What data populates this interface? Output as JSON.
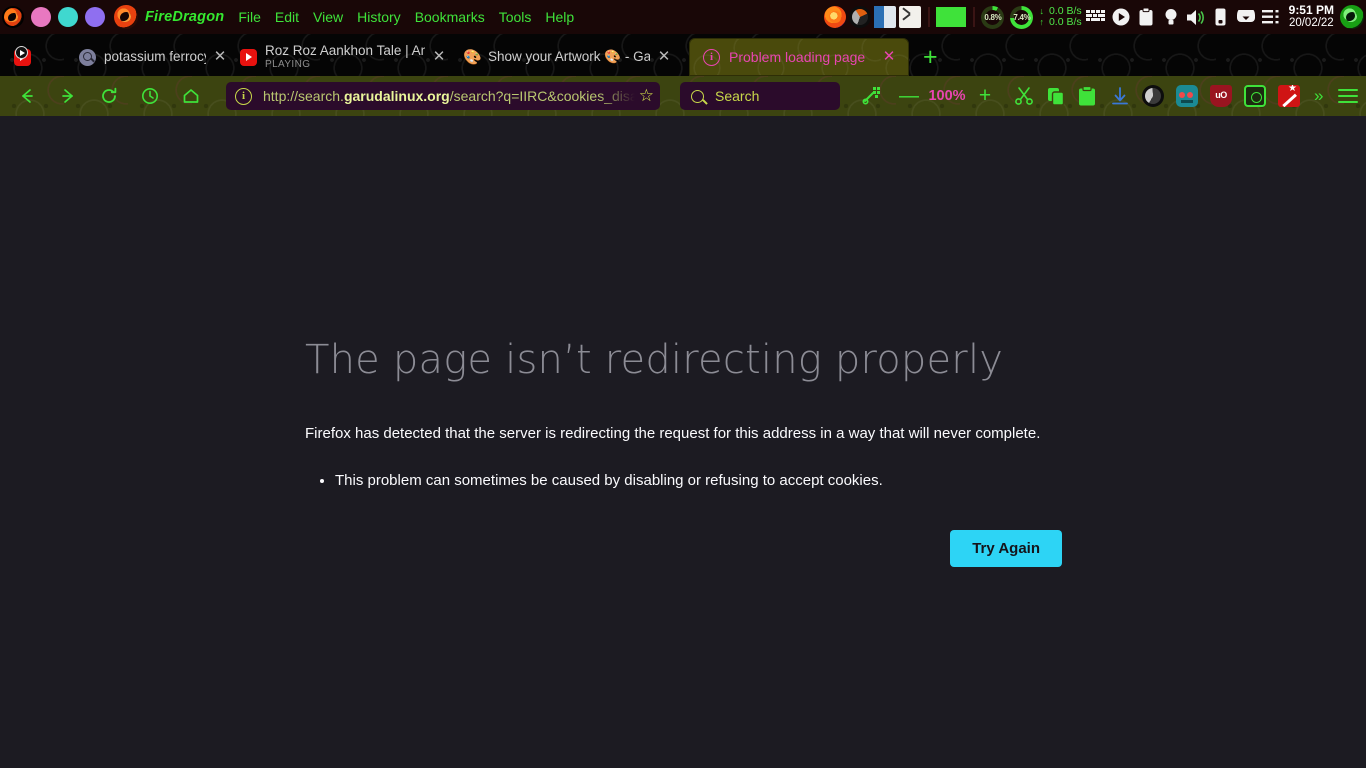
{
  "desktop_panel": {
    "app_name": "FireDragon",
    "menus": [
      "File",
      "Edit",
      "View",
      "History",
      "Bookmarks",
      "Tools",
      "Help"
    ],
    "window_controls": [
      "close-circle",
      "minimize-circle",
      "maximize-circle"
    ],
    "tray": {
      "app_icons": [
        "firefox-icon",
        "dragon-icon",
        "file-manager-icon",
        "terminal-icon"
      ],
      "cpu_label": "0.8%",
      "mem_label": "7.4%",
      "net_down": "0.0 B/s",
      "net_up": "0.0 B/s",
      "status_icons": [
        "keyboard-icon",
        "media-play-icon",
        "clipboard-icon",
        "bulb-icon",
        "volume-icon",
        "battery-icon",
        "cloud-icon",
        "menu-list-icon"
      ],
      "clock_time": "9:51 PM",
      "clock_date": "20/02/22"
    },
    "colors": {
      "panel_bg": "#190707",
      "menu_text": "#3fe23a",
      "app_name_text": "#35e830"
    }
  },
  "tabs": [
    {
      "title": "potassium ferrocyanide - W",
      "subtitle": "",
      "favicon": "search-favicon",
      "active": false,
      "close_label": "✕"
    },
    {
      "title": "Roz Roz Aankhon Tale | Ami",
      "subtitle": "PLAYING",
      "favicon": "youtube-favicon",
      "active": false,
      "close_label": "✕"
    },
    {
      "title": "Show your Artwork 🎨 - Ga",
      "subtitle": "",
      "favicon": "artwork-favicon",
      "active": false,
      "close_label": "✕"
    },
    {
      "title": "Problem loading page",
      "subtitle": "",
      "favicon": "info-favicon",
      "active": true,
      "close_label": "✕"
    }
  ],
  "new_tab_label": "+",
  "toolbar": {
    "back_label": "←",
    "forward_label": "→",
    "reload_label": "⟳",
    "history_label": "◴",
    "home_label": "⌂",
    "url": {
      "scheme": "http://search.",
      "domain": "garudalinux.org",
      "path": "/search?q=IIRC&cookies_disa",
      "full": "http://search.garudalinux.org/search?q=IIRC&cookies_disa",
      "identity_icon": "info-circle-icon",
      "bookmark_star": "☆"
    },
    "search": {
      "placeholder": "Search",
      "icon": "search-icon"
    },
    "zoom_out_label": "—",
    "zoom_level": "100%",
    "zoom_in_label": "+",
    "actions": [
      "screenshot-icon",
      "cut-icon",
      "copy-icon",
      "paste-icon",
      "download-icon"
    ],
    "extensions": [
      "dark-circle-extension-icon",
      "robot-extension-icon",
      "ublock-origin-icon",
      "green-note-extension-icon",
      "magic-wand-extension-icon"
    ],
    "ublock_label": "uO",
    "overflow_label": "»",
    "menu_label": "menu-icon"
  },
  "page": {
    "title": "The page isn’t redirecting properly",
    "description": "Firefox has detected that the server is redirecting the request for this address in a way that will never complete.",
    "bullets": [
      "This problem can sometimes be caused by disabling or refusing to accept cookies."
    ],
    "button_label": "Try Again",
    "colors": {
      "background": "#1c1b22",
      "title_text": "#8c8c95",
      "body_text": "#fbfbfe",
      "button_bg": "#2dd4f5",
      "button_text": "#15141a"
    }
  }
}
